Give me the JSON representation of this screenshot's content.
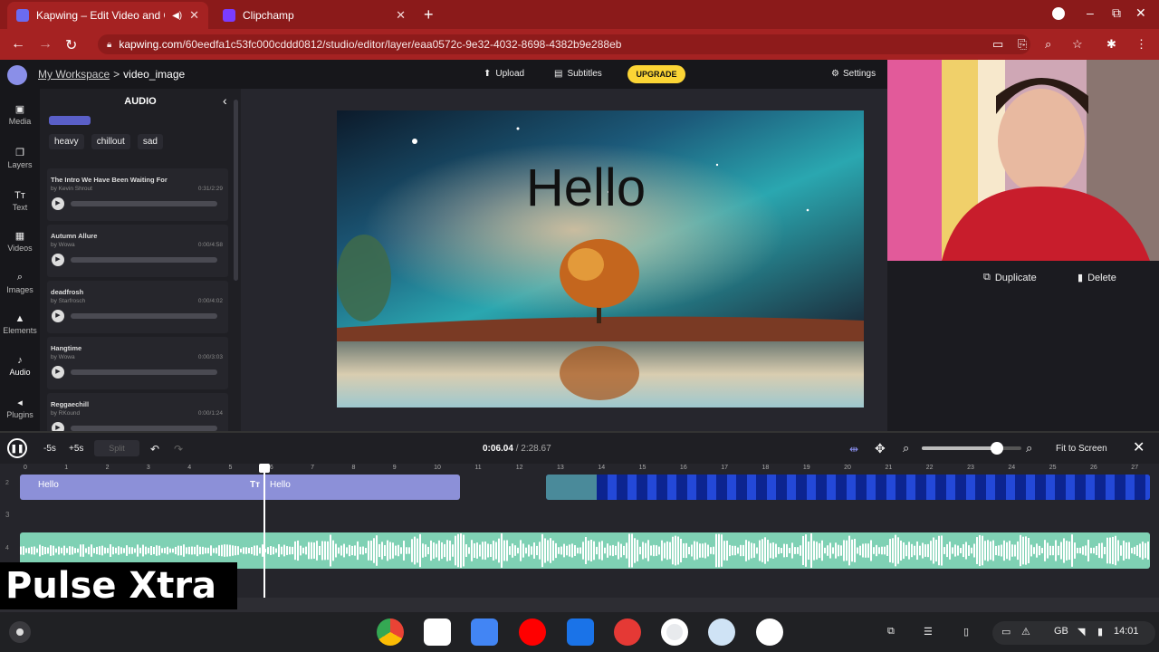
{
  "browser": {
    "tabs": [
      {
        "title": "Kapwing – Edit Video and C",
        "active": true
      },
      {
        "title": "Clipchamp",
        "active": false
      }
    ],
    "url_host": "kapwing.com",
    "url_path": "/60eedfa1c53fc000cddd0812/studio/editor/layer/eaa0572c-9e32-4032-8698-4382b9e288eb"
  },
  "app": {
    "breadcrumb_workspace": "My Workspace",
    "breadcrumb_sep": ">",
    "project_name": "video_image",
    "upload_label": "Upload",
    "subtitles_label": "Subtitles",
    "upgrade_label": "UPGRADE",
    "settings_label": "Settings",
    "accent_color": "#fcd535"
  },
  "rail": [
    {
      "label": "Media",
      "icon": "media-icon"
    },
    {
      "label": "Layers",
      "icon": "layers-icon"
    },
    {
      "label": "Text",
      "icon": "text-icon"
    },
    {
      "label": "Videos",
      "icon": "videos-icon"
    },
    {
      "label": "Images",
      "icon": "images-icon"
    },
    {
      "label": "Elements",
      "icon": "elements-icon"
    },
    {
      "label": "Audio",
      "icon": "audio-icon"
    },
    {
      "label": "Plugins",
      "icon": "plugins-icon"
    }
  ],
  "audio_panel": {
    "title": "AUDIO",
    "tags": [
      "heavy",
      "chillout",
      "sad"
    ],
    "tracks": [
      {
        "name": "The Intro We Have Been Waiting For",
        "by": "by Kevin Shrout",
        "duration": "0:31/2:29"
      },
      {
        "name": "Autumn Allure",
        "by": "by Wowa",
        "duration": "0:00/4:58"
      },
      {
        "name": "deadfrosh",
        "by": "by Starfrosch",
        "duration": "0:00/4:02"
      },
      {
        "name": "Hangtime",
        "by": "by Wowa",
        "duration": "0:00/3:03"
      },
      {
        "name": "Reggaechill",
        "by": "by RKound",
        "duration": "0:00/1:24"
      }
    ]
  },
  "canvas": {
    "overlay_text": "Hello"
  },
  "right_panel": {
    "duplicate_label": "Duplicate",
    "delete_label": "Delete"
  },
  "timeline": {
    "back_label": "-5s",
    "fwd_label": "+5s",
    "split_label": "Split",
    "current_time": "0:06.04",
    "total_time": "/ 2:28.67",
    "fit_label": "Fit to Screen",
    "ruler_ticks": [
      "0",
      "1",
      "2",
      "3",
      "4",
      "5",
      "6",
      "7",
      "8",
      "9",
      "10",
      "11",
      "12",
      "13",
      "14",
      "15",
      "16",
      "17",
      "18",
      "19",
      "20",
      "21",
      "22",
      "23",
      "24",
      "25",
      "26",
      "27"
    ],
    "clip1_label": "Hello",
    "clip2_label": "Hello",
    "track_numbers": [
      "2",
      "3",
      "4"
    ],
    "zoom_level": 0.75
  },
  "watermark": "Pulse Xtra",
  "shelf": {
    "apps": [
      "chrome-icon",
      "gmail-icon",
      "docs-icon",
      "youtube-icon",
      "files-icon",
      "screen-recorder-icon",
      "camera-icon",
      "clipchamp-icon",
      "assistant-icon"
    ],
    "keyboard": "GB",
    "time": "14:01"
  }
}
